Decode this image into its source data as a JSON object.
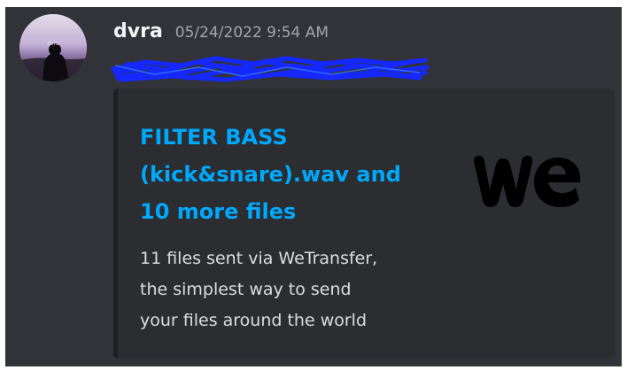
{
  "message": {
    "author": "dvra",
    "timestamp": "05/24/2022 9:54 AM",
    "avatar_text": "dvra",
    "link_redacted": true
  },
  "embed": {
    "title": "FILTER BASS\n(kick&snare).wav and\n10 more files",
    "description": "11 files sent via WeTransfer,\nthe simplest way to send\nyour files around the world",
    "thumbnail_logo_text": "we",
    "colors": {
      "title": "#00a8fc",
      "description": "#dbdee1",
      "background": "#2b2d31",
      "accent_bar": "#1e1f22"
    }
  },
  "colors": {
    "chat_background": "#313338",
    "username": "#f2f3f5",
    "timestamp": "#a3a6aa",
    "redaction_scribble": "#1428ff"
  }
}
